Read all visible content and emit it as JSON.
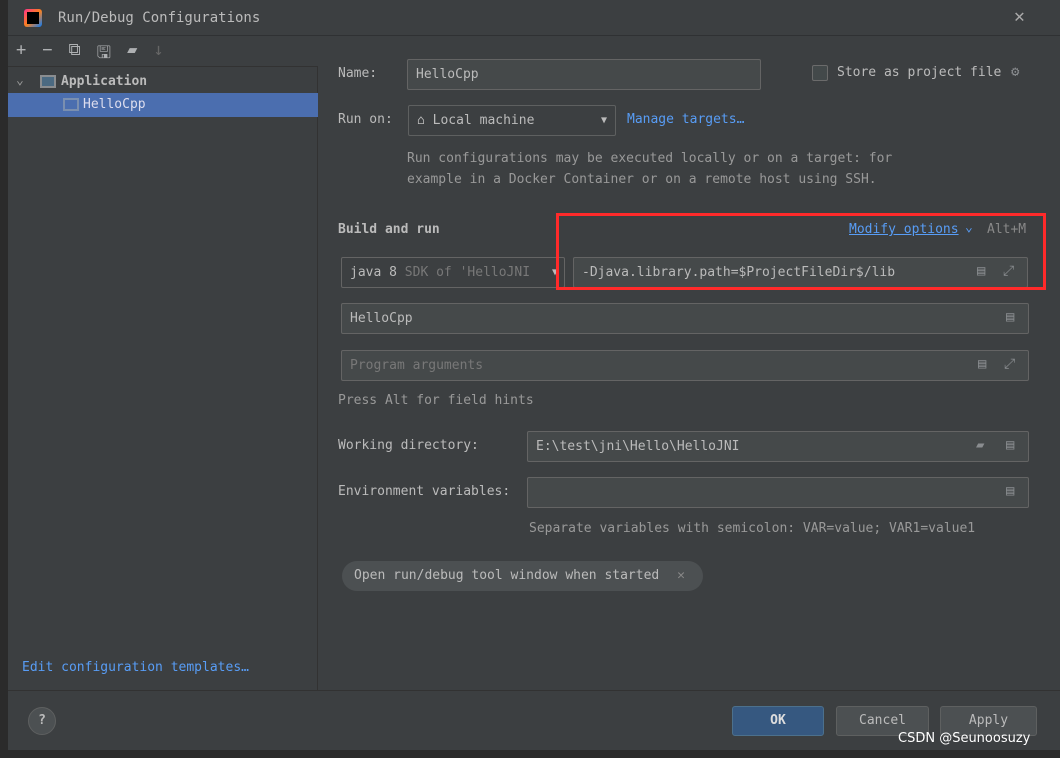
{
  "title": "Run/Debug Configurations",
  "toolbar": [
    "add-icon",
    "remove-icon",
    "copy-icon",
    "save-icon",
    "new-folder-icon",
    "sort-icon"
  ],
  "tree": {
    "group": "Application",
    "item": "HelloCpp"
  },
  "left_footer": "Edit configuration templates…",
  "name": {
    "label": "Name:",
    "value": "HelloCpp"
  },
  "store": {
    "label": "Store as project file",
    "checked": false
  },
  "run_on": {
    "label": "Run on:",
    "value": "Local machine",
    "manage": "Manage targets…",
    "hint1": "Run configurations may be executed locally or on a target: for",
    "hint2": "example in a Docker Container or on a remote host using SSH."
  },
  "build": {
    "title": "Build and run",
    "modify": "Modify options",
    "shortcut": "Alt+M",
    "sdk_main": "java 8",
    "sdk_sub": "SDK of 'HelloJNI",
    "vm_options": "-Djava.library.path=$ProjectFileDir$/lib",
    "main_class": "HelloCpp",
    "program_args_placeholder": "Program arguments",
    "field_hint": "Press Alt for field hints"
  },
  "working_dir": {
    "label": "Working directory:",
    "value": "E:\\test\\jni\\Hello\\HelloJNI"
  },
  "env": {
    "label": "Environment variables:",
    "value": "",
    "hint": "Separate variables with semicolon: VAR=value; VAR1=value1"
  },
  "chip": "Open run/debug tool window when started",
  "buttons": {
    "ok": "OK",
    "cancel": "Cancel",
    "apply": "Apply",
    "help": "?"
  },
  "watermark": "CSDN @Seunoosuzy",
  "highlight_color": "#ff2a2a",
  "accent": "#365880"
}
